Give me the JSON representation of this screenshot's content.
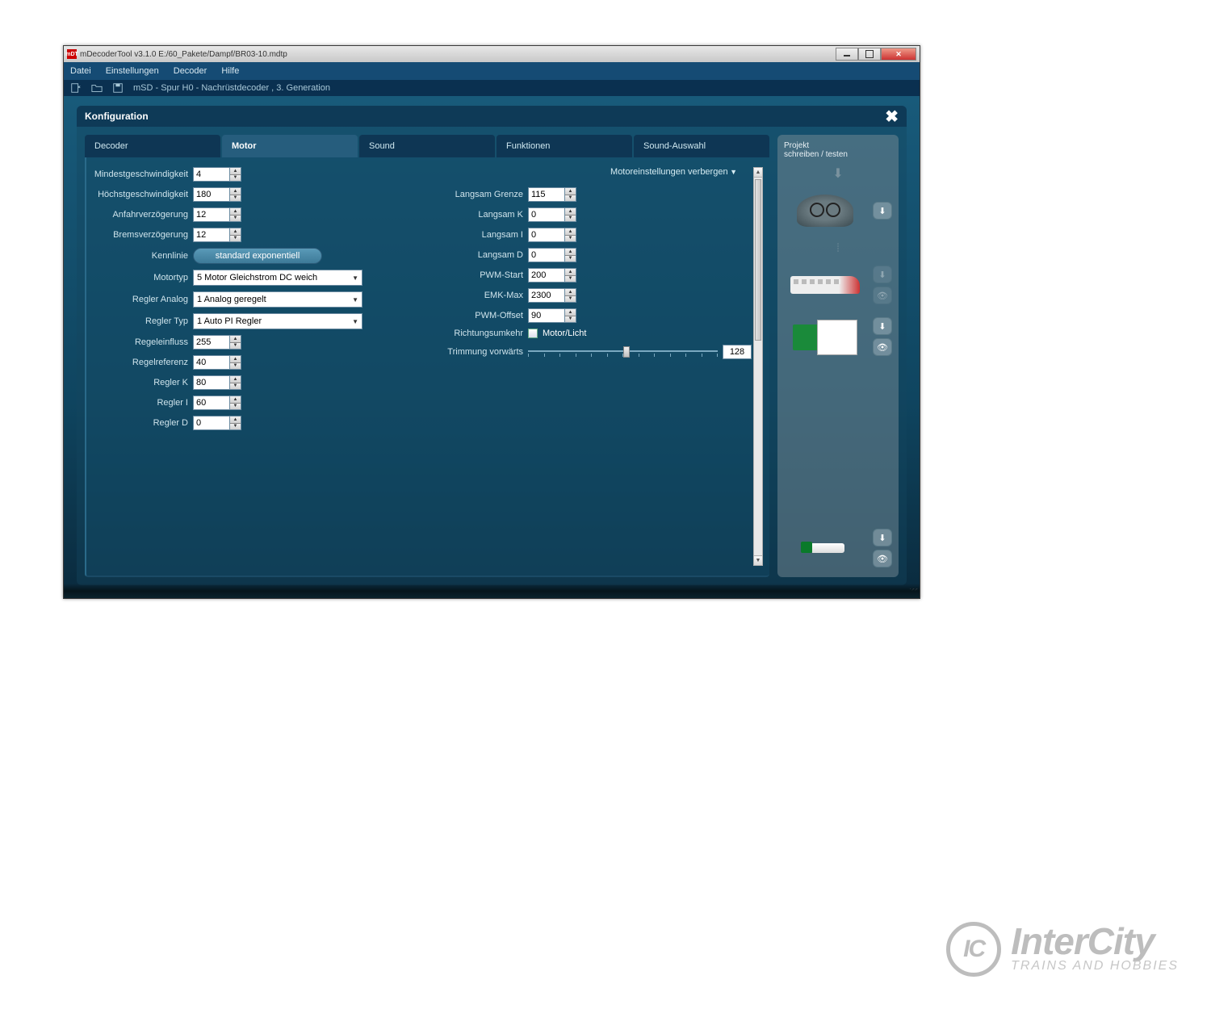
{
  "window": {
    "title": "mDecoderTool v3.1.0  E:/60_Pakete/Dampf/BR03-10.mdtp",
    "icon_text": "mDT"
  },
  "menu": {
    "items": [
      "Datei",
      "Einstellungen",
      "Decoder",
      "Hilfe"
    ]
  },
  "toolbar": {
    "breadcrumb": "mSD - Spur H0 - Nachrüstdecoder , 3. Generation"
  },
  "panel": {
    "title": "Konfiguration",
    "tabs": [
      "Decoder",
      "Motor",
      "Sound",
      "Funktionen",
      "Sound-Auswahl"
    ],
    "active_tab_index": 1,
    "hide_label": "Motoreinstellungen verbergen"
  },
  "left_form": {
    "mindest": {
      "label": "Mindestgeschwindigkeit",
      "value": "4"
    },
    "hoechst": {
      "label": "Höchstgeschwindigkeit",
      "value": "180"
    },
    "anfahr": {
      "label": "Anfahrverzögerung",
      "value": "12"
    },
    "brems": {
      "label": "Bremsverzögerung",
      "value": "12"
    },
    "kennlinie": {
      "label": "Kennlinie",
      "button": "standard exponentiell"
    },
    "motortyp": {
      "label": "Motortyp",
      "value": "5 Motor Gleichstrom DC weich"
    },
    "regler_analog": {
      "label": "Regler Analog",
      "value": "1 Analog geregelt"
    },
    "regler_typ": {
      "label": "Regler Typ",
      "value": "1 Auto PI Regler"
    },
    "regeleinfluss": {
      "label": "Regeleinfluss",
      "value": "255"
    },
    "regelreferenz": {
      "label": "Regelreferenz",
      "value": "40"
    },
    "regler_k": {
      "label": "Regler K",
      "value": "80"
    },
    "regler_i": {
      "label": "Regler I",
      "value": "60"
    },
    "regler_d": {
      "label": "Regler D",
      "value": "0"
    }
  },
  "right_form": {
    "langsam_grenze": {
      "label": "Langsam Grenze",
      "value": "115"
    },
    "langsam_k": {
      "label": "Langsam K",
      "value": "0"
    },
    "langsam_i": {
      "label": "Langsam I",
      "value": "0"
    },
    "langsam_d": {
      "label": "Langsam D",
      "value": "0"
    },
    "pwm_start": {
      "label": "PWM-Start",
      "value": "200"
    },
    "emk_max": {
      "label": "EMK-Max",
      "value": "2300"
    },
    "pwm_offset": {
      "label": "PWM-Offset",
      "value": "90"
    },
    "richtung": {
      "label": "Richtungsumkehr",
      "check_label": "Motor/Licht"
    },
    "trimmung": {
      "label": "Trimmung vorwärts",
      "value": "128"
    }
  },
  "sidebar": {
    "title": "Projekt\nschreiben / testen"
  },
  "watermark": {
    "icon": "IC",
    "main": "InterCity",
    "sub": "TRAINS AND HOBBIES"
  }
}
